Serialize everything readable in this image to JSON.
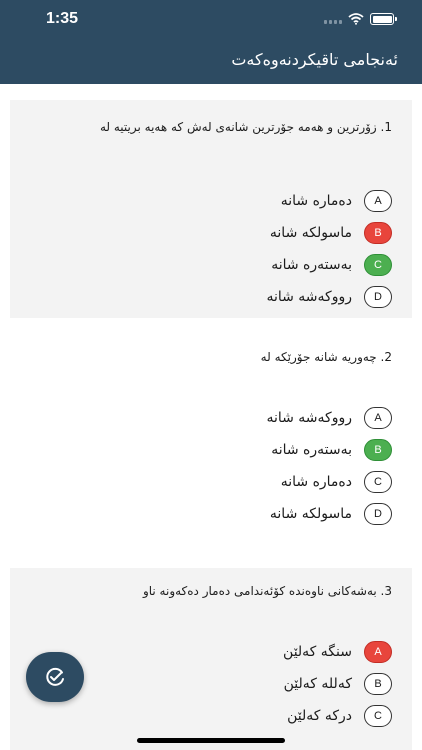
{
  "status": {
    "time": "1:35"
  },
  "header": {
    "title": "ئەنجامی تاقیکردنەوەکەت"
  },
  "questions": [
    {
      "text": "1. زۆرترین و هەمە جۆرترین شانەی لەش کە هەیە بریتیە لە",
      "options": [
        {
          "letter": "A",
          "label": "دەمارە شانە",
          "state": "none"
        },
        {
          "letter": "B",
          "label": "ماسولکە شانە",
          "state": "wrong"
        },
        {
          "letter": "C",
          "label": "بەستەرە شانە",
          "state": "correct"
        },
        {
          "letter": "D",
          "label": "رووکەشە شانە",
          "state": "none"
        }
      ]
    },
    {
      "text": "2. چەوریە شانە جۆرێکە لە",
      "options": [
        {
          "letter": "A",
          "label": "رووکەشە شانە",
          "state": "none"
        },
        {
          "letter": "B",
          "label": "بەستەرە شانە",
          "state": "correct"
        },
        {
          "letter": "C",
          "label": "دەمارە شانە",
          "state": "none"
        },
        {
          "letter": "D",
          "label": "ماسولکە شانە",
          "state": "none"
        }
      ]
    },
    {
      "text": "3. بەشەکانی ناوەندە کۆئەندامی دەمار دەکەونە ناو",
      "options": [
        {
          "letter": "A",
          "label": "سنگە کەلێن",
          "state": "wrong"
        },
        {
          "letter": "B",
          "label": "کەللە کەلێن",
          "state": "none"
        },
        {
          "letter": "C",
          "label": "دركە کەلێن",
          "state": "none"
        }
      ]
    }
  ],
  "colors": {
    "header": "#2d4b62",
    "wrong": "#e8453c",
    "correct": "#4caf50",
    "shaded": "#f3f3f3"
  },
  "fab": {
    "icon": "check-circle-icon"
  }
}
